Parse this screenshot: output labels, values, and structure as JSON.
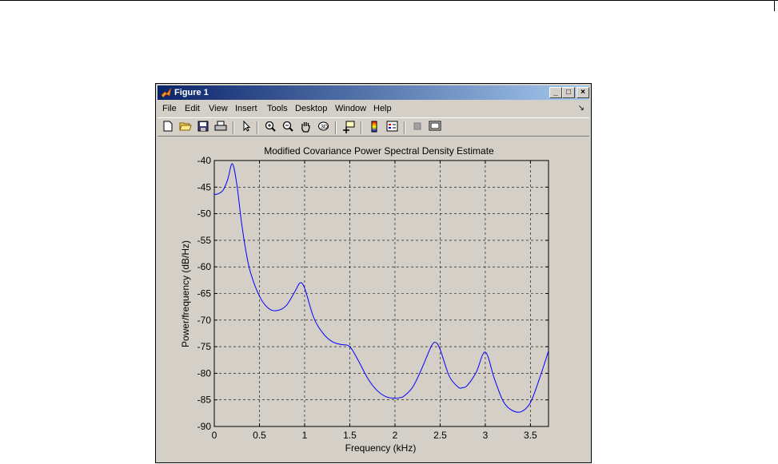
{
  "window": {
    "title": "Figure 1",
    "controls": {
      "minimize": "_",
      "maximize": "□",
      "close": "×"
    }
  },
  "menu": [
    "File",
    "Edit",
    "View",
    "Insert",
    "Tools",
    "Desktop",
    "Window",
    "Help"
  ],
  "toolbar_icons": [
    "new-figure-icon",
    "open-file-icon",
    "save-icon",
    "print-icon",
    "edit-plot-arrow-icon",
    "zoom-in-icon",
    "zoom-out-icon",
    "pan-hand-icon",
    "rotate-3d-icon",
    "data-cursor-icon",
    "insert-colorbar-icon",
    "insert-legend-icon",
    "hide-plot-tools-icon",
    "show-plot-tools-icon"
  ],
  "chart_data": {
    "type": "line",
    "title": "Modified Covariance Power Spectral Density Estimate",
    "xlabel": "Frequency (kHz)",
    "ylabel": "Power/frequency (dB/Hz)",
    "xlim": [
      0,
      3.7
    ],
    "ylim": [
      -90,
      -40
    ],
    "xticks": [
      0,
      0.5,
      1,
      1.5,
      2,
      2.5,
      3,
      3.5
    ],
    "xtick_labels": [
      "0",
      "0.5",
      "1",
      "1.5",
      "2",
      "2.5",
      "3",
      "3.5"
    ],
    "yticks": [
      -40,
      -45,
      -50,
      -55,
      -60,
      -65,
      -70,
      -75,
      -80,
      -85,
      -90
    ],
    "ytick_labels": [
      "-40",
      "-45",
      "-50",
      "-55",
      "-60",
      "-65",
      "-70",
      "-75",
      "-80",
      "-85",
      "-90"
    ],
    "grid": true,
    "line_color": "#0000ff",
    "series": [
      {
        "x": [
          0,
          0.05,
          0.1,
          0.15,
          0.2,
          0.25,
          0.3,
          0.35,
          0.4,
          0.5,
          0.6,
          0.7,
          0.8,
          0.9,
          0.95,
          1.0,
          1.1,
          1.2,
          1.3,
          1.4,
          1.5,
          1.6,
          1.7,
          1.8,
          1.9,
          2.0,
          2.05,
          2.1,
          2.2,
          2.3,
          2.4,
          2.45,
          2.5,
          2.6,
          2.7,
          2.75,
          2.8,
          2.9,
          3.0,
          3.1,
          3.2,
          3.3,
          3.4,
          3.5,
          3.6,
          3.7
        ],
        "y": [
          -46.4,
          -46.2,
          -45.5,
          -43.5,
          -40.6,
          -44.5,
          -51.5,
          -57,
          -61,
          -65.5,
          -67.8,
          -68.2,
          -67.2,
          -64.4,
          -63.0,
          -64.0,
          -69.5,
          -72.4,
          -74,
          -74.6,
          -75.0,
          -77.8,
          -81,
          -83.2,
          -84.4,
          -84.7,
          -84.6,
          -84.3,
          -82.5,
          -79,
          -75,
          -74.2,
          -75.5,
          -80.5,
          -82.6,
          -82.7,
          -82.3,
          -79.8,
          -76.0,
          -81,
          -85.3,
          -87,
          -87.2,
          -85.5,
          -81,
          -75.8
        ]
      }
    ]
  }
}
